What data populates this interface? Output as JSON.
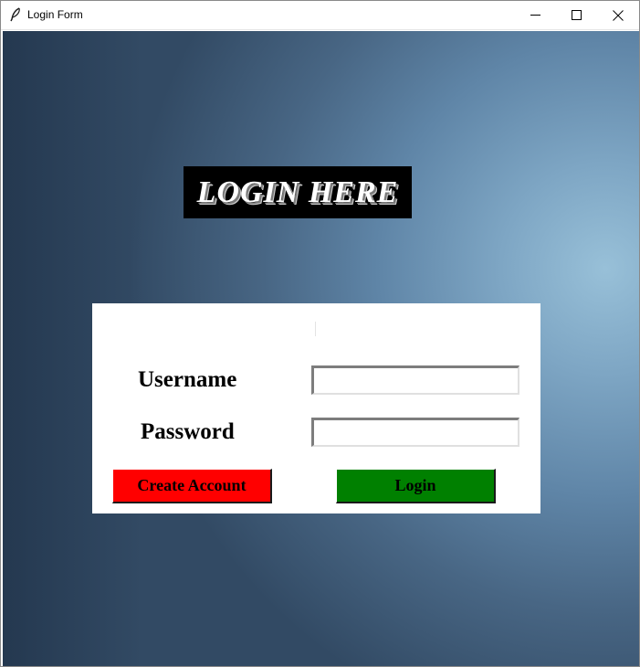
{
  "window": {
    "title": "Login Form",
    "icon": "feather-icon",
    "controls": {
      "minimize": "minimize-icon",
      "maximize": "maximize-icon",
      "close": "close-icon"
    }
  },
  "banner": {
    "text": "LOGIN HERE"
  },
  "form": {
    "username_label": "Username",
    "username_value": "",
    "password_label": "Password",
    "password_value": "",
    "create_account_label": "Create Account",
    "login_label": "Login"
  },
  "colors": {
    "banner_bg": "#000000",
    "create_button": "#ff0000",
    "login_button": "#008000",
    "panel_bg": "#ffffff"
  }
}
